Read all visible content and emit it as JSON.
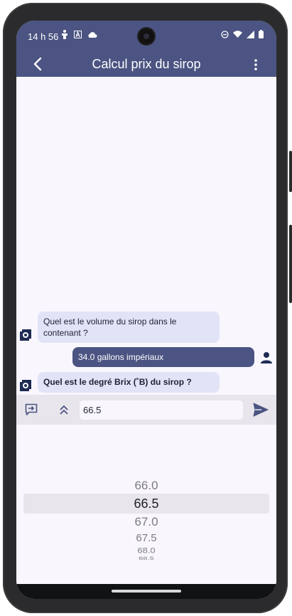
{
  "status": {
    "time": "14 h 56",
    "left_icons": [
      "accessibility-icon",
      "notification-a-icon",
      "cloud-icon"
    ],
    "right_icons": [
      "do-not-disturb-icon",
      "wifi-icon",
      "signal-icon",
      "battery-icon"
    ]
  },
  "appbar": {
    "title": "Calcul prix du sirop"
  },
  "chat": {
    "messages": [
      {
        "role": "bot",
        "text_line1": "Quel est le volume du sirop dans le",
        "text_line2": "contenant ?"
      },
      {
        "role": "user",
        "text": "34.0 gallons impériaux"
      },
      {
        "role": "bot",
        "text": "Quel est le degré Brix (˚B) du sirop ?"
      }
    ]
  },
  "input": {
    "value": "66.5"
  },
  "picker": {
    "options": [
      "66.0",
      "66.5",
      "67.0",
      "67.5",
      "68.0",
      "68.5"
    ],
    "selected": "66.5"
  },
  "colors": {
    "primary": "#4b5482",
    "bot_bubble": "#e1e3f7",
    "background": "#f9f7fd",
    "input_bar": "#e8e6ec"
  }
}
